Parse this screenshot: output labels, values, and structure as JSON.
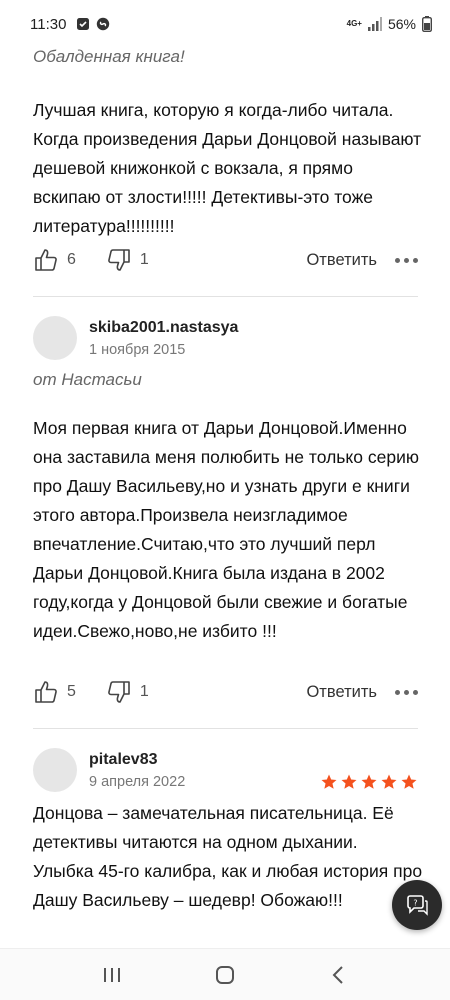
{
  "status": {
    "time": "11:30",
    "network": "4G+",
    "battery": "56%"
  },
  "reviews": [
    {
      "subtitle": "Обалденная книга!",
      "text": "Лучшая книга, которую я когда-либо читала. Когда произведения Дарьи Донцовой называют дешевой книжонкой с вокзала, я прямо вскипаю от злости!!!!! Детективы-это тоже литература!!!!!!!!!!",
      "likes": "6",
      "dislikes": "1",
      "reply_label": "Ответить"
    },
    {
      "author": "skiba2001.nastasya",
      "date": "1 ноября 2015",
      "subtitle": "от Настасьи",
      "text": "Моя первая книга от Дарьи Донцовой.Именно она заставила меня полюбить не только серию про Дашу Васильеву,но и узнать други е книги этого автора.Произвела неизгладимое впечатление.Считаю,что это лучший перл Дарьи Донцовой.Книга была издана в 2002 году,когда у Донцовой были свежие и богатые идеи.Свежо,ново,не избито !!!",
      "likes": "5",
      "dislikes": "1",
      "reply_label": "Ответить"
    },
    {
      "author": "pitalev83",
      "date": "9 апреля 2022",
      "rating": 5,
      "text": "Донцова – замечательная писательница. Её детективы читаются на одном дыхании. Улыбка 45-го калибра, как и любая история про Дашу Васильеву – шедевр! Обожаю!!!"
    }
  ],
  "colors": {
    "star": "#f4511e",
    "fab": "#2b2b2b"
  },
  "icons": {
    "like": "thumbs-up-icon",
    "dislike": "thumbs-down-icon",
    "more": "more-dots-icon",
    "fab": "chat-help-icon",
    "nav": [
      "recent-apps-icon",
      "home-icon",
      "back-icon"
    ]
  }
}
